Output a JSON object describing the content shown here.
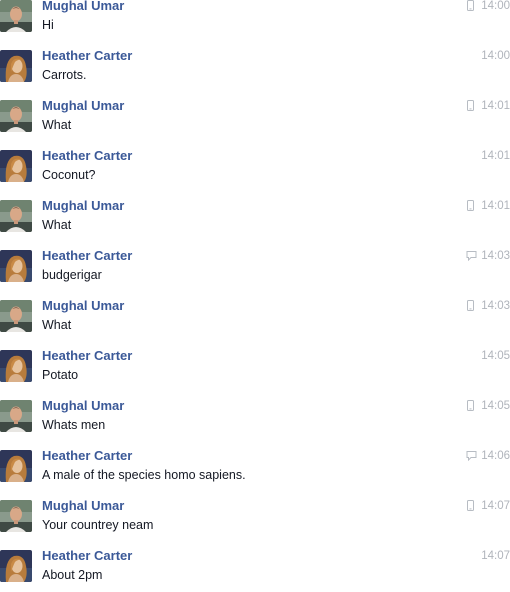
{
  "colors": {
    "sender_name": "#3b5998",
    "message_text": "#141823",
    "timestamp": "#b0b4bb"
  },
  "messages": [
    {
      "sender": "Mughal Umar",
      "text": "Hi",
      "time": "14:00",
      "source_icon": "mobile-icon",
      "avatar": "mughal"
    },
    {
      "sender": "Heather Carter",
      "text": "Carrots.",
      "time": "14:00",
      "source_icon": "",
      "avatar": "heather"
    },
    {
      "sender": "Mughal Umar",
      "text": "What",
      "time": "14:01",
      "source_icon": "mobile-icon",
      "avatar": "mughal"
    },
    {
      "sender": "Heather Carter",
      "text": "Coconut?",
      "time": "14:01",
      "source_icon": "",
      "avatar": "heather"
    },
    {
      "sender": "Mughal Umar",
      "text": "What",
      "time": "14:01",
      "source_icon": "mobile-icon",
      "avatar": "mughal"
    },
    {
      "sender": "Heather Carter",
      "text": "budgerigar",
      "time": "14:03",
      "source_icon": "chat-icon",
      "avatar": "heather"
    },
    {
      "sender": "Mughal Umar",
      "text": "What",
      "time": "14:03",
      "source_icon": "mobile-icon",
      "avatar": "mughal"
    },
    {
      "sender": "Heather Carter",
      "text": "Potato",
      "time": "14:05",
      "source_icon": "",
      "avatar": "heather"
    },
    {
      "sender": "Mughal Umar",
      "text": "Whats men",
      "time": "14:05",
      "source_icon": "mobile-icon",
      "avatar": "mughal"
    },
    {
      "sender": "Heather Carter",
      "text": "A male of the species homo sapiens.",
      "time": "14:06",
      "source_icon": "chat-icon",
      "avatar": "heather"
    },
    {
      "sender": "Mughal Umar",
      "text": "Your countrey neam",
      "time": "14:07",
      "source_icon": "mobile-icon",
      "avatar": "mughal"
    },
    {
      "sender": "Heather Carter",
      "text": "About 2pm",
      "time": "14:07",
      "source_icon": "",
      "avatar": "heather"
    }
  ]
}
